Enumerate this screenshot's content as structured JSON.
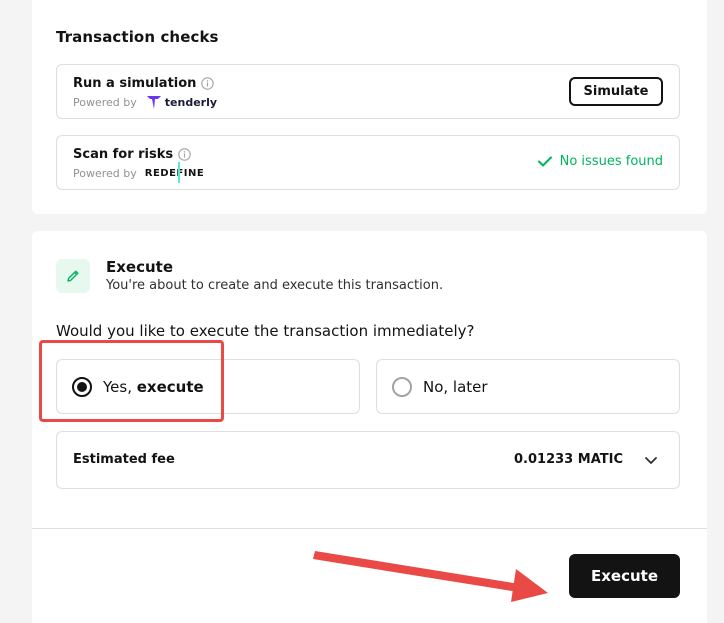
{
  "checks": {
    "title": "Transaction checks",
    "simulation": {
      "title": "Run a simulation",
      "powered_by": "Powered by",
      "provider": "tenderly",
      "button": "Simulate"
    },
    "scan": {
      "title": "Scan for risks",
      "powered_by": "Powered by",
      "provider": "REDEFINE",
      "status": "No issues found"
    }
  },
  "execute": {
    "title": "Execute",
    "subtitle": "You're about to create and execute this transaction.",
    "question": "Would you like to execute the transaction immediately?",
    "options": [
      {
        "label_prefix": "Yes, ",
        "label_bold": "execute",
        "selected": true
      },
      {
        "label": "No, later",
        "selected": false
      }
    ],
    "fee": {
      "label": "Estimated fee",
      "value": "0.01233 MATIC"
    },
    "button": "Execute"
  },
  "colors": {
    "success": "#00b460",
    "annotation": "#e94a45",
    "primary": "#121312",
    "redefine_accent": "#55ead3"
  },
  "icons": [
    "info-icon",
    "tenderly-logo-icon",
    "check-icon",
    "pencil-icon",
    "chevron-down-icon"
  ]
}
